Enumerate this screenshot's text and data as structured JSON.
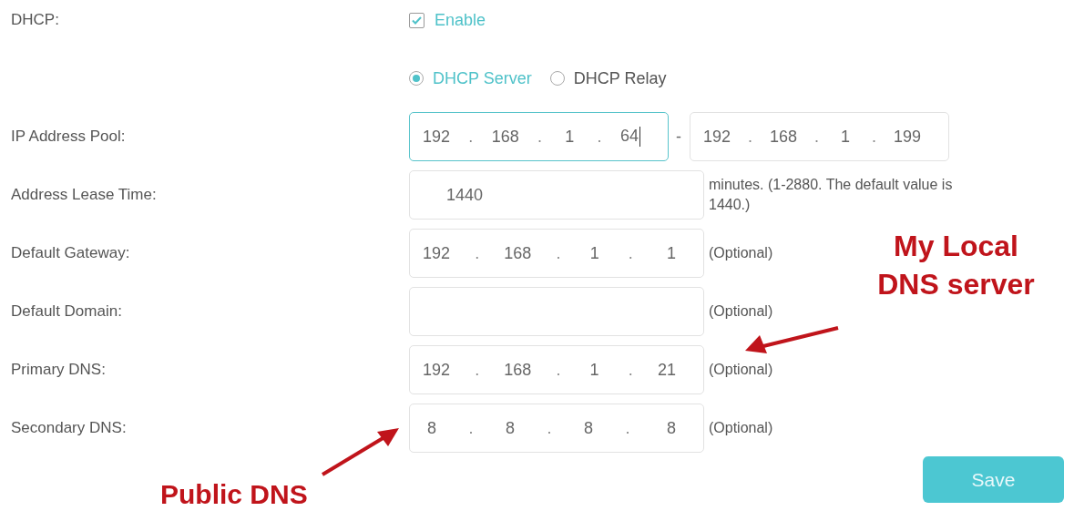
{
  "dhcp": {
    "label": "DHCP:",
    "checkbox": {
      "label": "Enable",
      "checked": true
    }
  },
  "mode": [
    {
      "label": "DHCP Server",
      "selected": true
    },
    {
      "label": "DHCP Relay",
      "selected": false
    }
  ],
  "fields": [
    {
      "kind": "range",
      "label": "IP Address Pool:",
      "from": [
        "192",
        "168",
        "1",
        "64"
      ],
      "separator": "-",
      "to": [
        "192",
        "168",
        "1",
        "199"
      ],
      "focused": true
    },
    {
      "kind": "text",
      "label": "Address Lease Time:",
      "value": "1440",
      "note": "minutes. (1-2880. The default value is 1440.)"
    },
    {
      "kind": "ip",
      "label": "Default Gateway:",
      "octets": [
        "192",
        "168",
        "1",
        "1"
      ],
      "note": "(Optional)"
    },
    {
      "kind": "text",
      "label": "Default Domain:",
      "note": "(Optional)"
    },
    {
      "kind": "ip",
      "label": "Primary DNS:",
      "octets": [
        "192",
        "168",
        "1",
        "21"
      ],
      "note": "(Optional)"
    },
    {
      "kind": "ip",
      "label": "Secondary DNS:",
      "octets": [
        "8",
        "8",
        "8",
        "8"
      ],
      "note": "(Optional)"
    }
  ],
  "octet_separator": ".",
  "save_button": "Save",
  "annotations": [
    {
      "kind": "local",
      "text": "My Local DNS server"
    },
    {
      "kind": "public",
      "text": "Public DNS"
    }
  ]
}
